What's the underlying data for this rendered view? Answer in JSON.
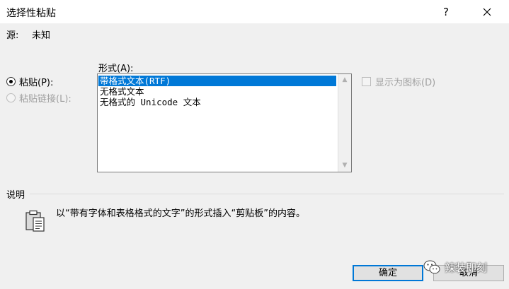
{
  "window": {
    "title": "选择性粘贴",
    "help_glyph": "?",
    "close_icon": "close-icon"
  },
  "source": {
    "label": "源:",
    "value": "未知"
  },
  "options": {
    "paste_label": "粘贴(P):",
    "paste_checked": true,
    "paste_link_label": "粘贴链接(L):",
    "paste_link_enabled": false
  },
  "format": {
    "label": "形式(A):",
    "items": [
      {
        "label": "带格式文本(RTF)",
        "selected": true
      },
      {
        "label": "无格式文本",
        "selected": false
      },
      {
        "label": "无格式的 Unicode 文本",
        "selected": false
      }
    ]
  },
  "display_as_icon": {
    "label": "显示为图标(D)",
    "checked": false,
    "enabled": false
  },
  "description": {
    "heading": "说明",
    "text": "以“带有字体和表格格式的文字”的形式插入“剪贴板”的内容。",
    "icon": "clipboard-icon"
  },
  "buttons": {
    "ok": "确定",
    "cancel": "取消"
  },
  "watermark": {
    "text": "辣装即刻",
    "icon": "wechat-icon"
  },
  "colors": {
    "selection": "#0078d7",
    "panel": "#f0f0f0",
    "button_face": "#e1e1e1",
    "default_button_border": "#0078d7"
  }
}
